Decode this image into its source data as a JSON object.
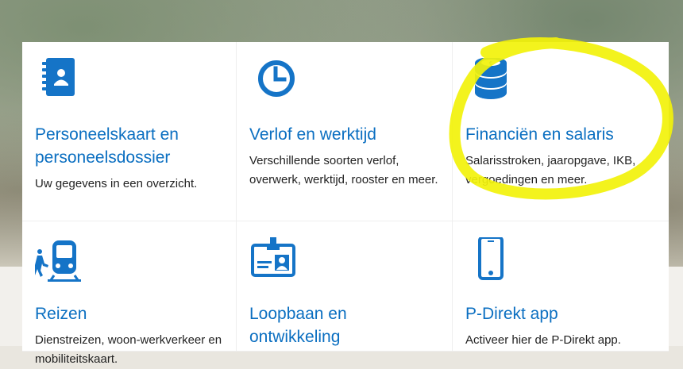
{
  "tiles": [
    {
      "title": "Personeelskaart en personeelsdossier",
      "description": "Uw gegevens in een overzicht.",
      "icon": "contact-card-icon"
    },
    {
      "title": "Verlof en werktijd",
      "description": "Verschillende soorten verlof, overwerk, werktijd, rooster en meer.",
      "icon": "clock-icon"
    },
    {
      "title": "Financiën en salaris",
      "description": "Salarisstroken, jaaropgave, IKB, vergoedingen en meer.",
      "icon": "coin-stack-icon"
    },
    {
      "title": "Reizen",
      "description": "Dienstreizen, woon-werkverkeer en mobiliteitskaart.",
      "icon": "train-traveler-icon"
    },
    {
      "title": "Loopbaan en ontwikkeling",
      "description": "",
      "icon": "id-badge-icon"
    },
    {
      "title": "P-Direkt app",
      "description": "Activeer hier de P-Direkt app.",
      "icon": "smartphone-icon"
    }
  ],
  "colors": {
    "accent": "#0b6fc1",
    "icon": "#1574c7",
    "highlight": "#f2f20a",
    "text": "#222222"
  }
}
